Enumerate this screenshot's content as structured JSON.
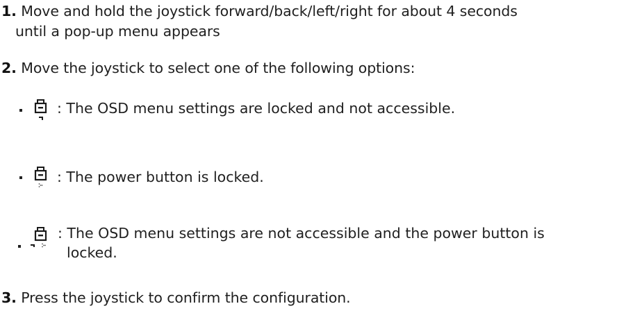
{
  "steps": [
    {
      "number": "1.",
      "line1": "Move and hold the joystick forward/back/left/right for about 4 seconds",
      "line2": "until a pop-up menu appears"
    },
    {
      "number": "2.",
      "text": "Move the joystick to select one of the following options:"
    },
    {
      "number": "3.",
      "text": "Press the joystick to confirm the configuration."
    }
  ],
  "options": [
    {
      "icon": "osd-lock-icon",
      "text": ": The OSD menu settings are locked and not accessible."
    },
    {
      "icon": "power-lock-icon",
      "text": ": The power button is locked."
    },
    {
      "icon": "osd-power-lock-icon",
      "line1": ": The OSD menu settings are not accessible and the power button is",
      "line2": "locked."
    }
  ]
}
